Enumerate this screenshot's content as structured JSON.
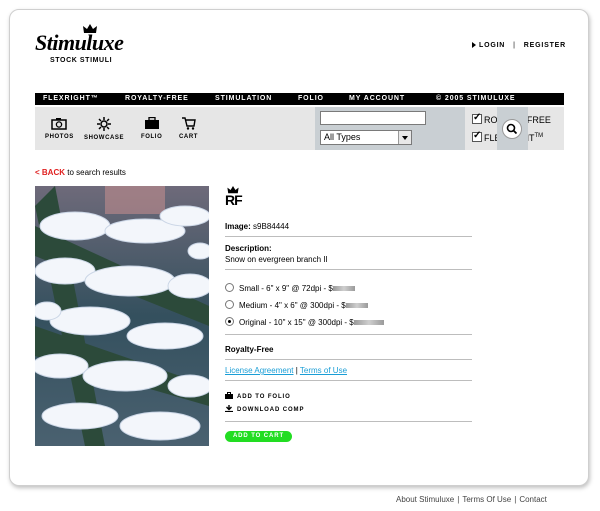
{
  "logo": {
    "name": "Stimuluxe",
    "tagline": "STOCK STIMULI"
  },
  "top_links": {
    "login": "LOGIN",
    "separator": "|",
    "register": "REGISTER"
  },
  "nav": [
    "FLEXRIGHT™",
    "ROYALTY-FREE",
    "STIMULATION",
    "FOLIO",
    "MY ACCOUNT",
    "© 2005 STIMULUXE"
  ],
  "tools": {
    "photos": "PHOTOS",
    "showcase": "SHOWCASE",
    "folio": "FOLIO",
    "cart": "CART"
  },
  "search": {
    "query": "",
    "type_selected": "All Types",
    "royalty_free_label": "ROYALTY-FREE",
    "flexright_label": "FLEXRIGHT",
    "flexright_tm": "TM"
  },
  "back": {
    "link": "< BACK",
    "text": " to search results"
  },
  "product": {
    "badge": "RF",
    "image_label": "Image:",
    "image_id": "s9B84444",
    "description_label": "Description:",
    "description": "Snow on evergreen branch II",
    "sizes": [
      {
        "label": "Small - 6\" x 9\" @ 72dpi - $",
        "selected": false
      },
      {
        "label": "Medium - 4\" x 6\" @ 300dpi - $",
        "selected": false
      },
      {
        "label": "Original - 10\" x 15\" @ 300dpi - $",
        "selected": true
      }
    ],
    "license_type": "Royalty-Free",
    "license_link": "License Agreement",
    "pipe": "|",
    "terms_link": "Terms of Use",
    "add_to_folio": "ADD TO FOLIO",
    "download_comp": "DOWNLOAD COMP",
    "add_to_cart": "ADD TO CART"
  },
  "footer": {
    "about": "About Stimuluxe",
    "sep": "|",
    "terms": "Terms Of Use",
    "contact": "Contact"
  },
  "colors": {
    "accent_red": "#e02020",
    "link_blue": "#1a9ed6",
    "cart_green": "#22dd22",
    "nav_black": "#000000"
  }
}
